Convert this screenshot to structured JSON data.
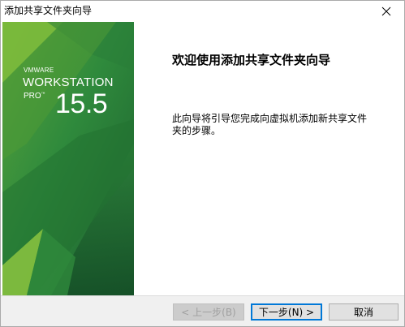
{
  "window": {
    "title": "添加共享文件夹向导"
  },
  "banner": {
    "vendor": "VMWARE",
    "product": "WORKSTATION",
    "edition": "PRO",
    "trademark": "™",
    "version": "15.5"
  },
  "content": {
    "heading": "欢迎使用添加共享文件夹向导",
    "description": "此向导将引导您完成向虚拟机添加新共享文件夹的步骤。"
  },
  "footer": {
    "back_label": "< 上一步(B)",
    "next_label": "下一步(N) >",
    "cancel_label": "取消"
  },
  "colors": {
    "accent": "#0078d7",
    "banner_dark": "#1b5e2e",
    "banner_mid": "#2f8a3c",
    "banner_light": "#7dbb3c"
  },
  "icons": {
    "close": "close-icon"
  }
}
